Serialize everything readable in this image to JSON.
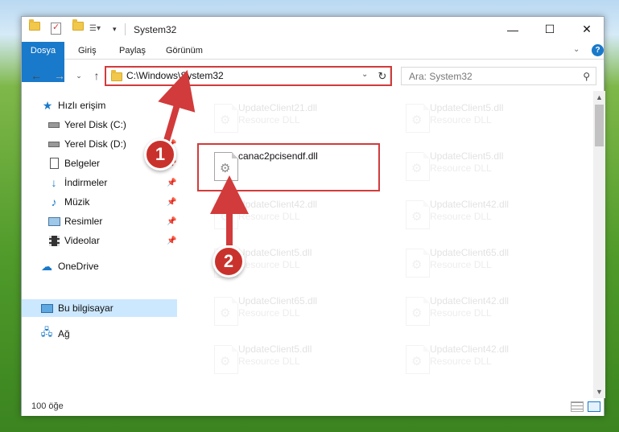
{
  "window": {
    "title": "System32",
    "controls": {
      "minimize": "—",
      "maximize": "☐",
      "close": "✕"
    }
  },
  "ribbon": {
    "tabs": [
      "Dosya",
      "Giriş",
      "Paylaş",
      "Görünüm"
    ],
    "expand_icon": "chevron-down-icon",
    "help": "?"
  },
  "address": {
    "path": "C:\\Windows\\System32",
    "search_placeholder": "Ara: System32"
  },
  "nav": {
    "items": [
      {
        "label": "Hızlı erişim",
        "icon": "star-icon"
      },
      {
        "label": "Yerel Disk (C:)",
        "icon": "drive-icon",
        "pinned": true
      },
      {
        "label": "Yerel Disk (D:)",
        "icon": "drive-icon",
        "pinned": true
      },
      {
        "label": "Belgeler",
        "icon": "documents-icon",
        "pinned": true
      },
      {
        "label": "İndirmeler",
        "icon": "download-icon",
        "pinned": true
      },
      {
        "label": "Müzik",
        "icon": "music-icon",
        "pinned": true
      },
      {
        "label": "Resimler",
        "icon": "pictures-icon",
        "pinned": true
      },
      {
        "label": "Videolar",
        "icon": "video-icon",
        "pinned": true
      },
      {
        "label": "OneDrive",
        "icon": "cloud-icon"
      },
      {
        "label": "Bu bilgisayar",
        "icon": "computer-icon",
        "selected": true
      },
      {
        "label": "Ağ",
        "icon": "network-icon"
      }
    ]
  },
  "files": {
    "highlighted": {
      "name": "canac2pcisendf.dll",
      "desc": ""
    },
    "col1": [
      {
        "name": "UpdateClient21.dll",
        "desc": "Resource DLL"
      },
      {
        "name": "UpdateClient42.dll",
        "desc": "Resource DLL"
      },
      {
        "name": "UpdateClient5.dll",
        "desc": "Resource DLL"
      },
      {
        "name": "UpdateClient65.dll",
        "desc": "Resource DLL"
      },
      {
        "name": "UpdateClient5.dll",
        "desc": "Resource DLL"
      }
    ],
    "col2": [
      {
        "name": "UpdateClient5.dll",
        "desc": "Resource DLL"
      },
      {
        "name": "UpdateClient5.dll",
        "desc": "Resource DLL"
      },
      {
        "name": "UpdateClient42.dll",
        "desc": "Resource DLL"
      },
      {
        "name": "UpdateClient65.dll",
        "desc": "Resource DLL"
      },
      {
        "name": "UpdateClient42.dll",
        "desc": "Resource DLL"
      },
      {
        "name": "UpdateClient42.dll",
        "desc": "Resource DLL"
      }
    ]
  },
  "status": {
    "count": "100 öğe"
  },
  "annotations": {
    "step1": "1",
    "step2": "2",
    "color": "#d23b3b"
  }
}
